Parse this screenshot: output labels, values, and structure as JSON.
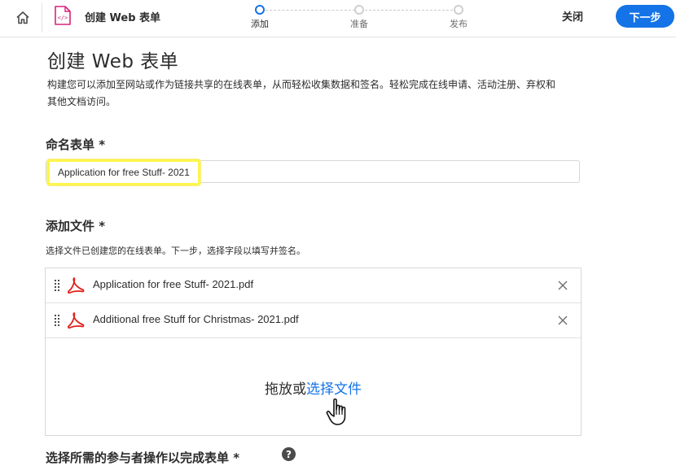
{
  "header": {
    "title": "创建 Web 表单",
    "steps": [
      {
        "label": "添加",
        "active": true
      },
      {
        "label": "准备",
        "active": false
      },
      {
        "label": "发布",
        "active": false
      }
    ],
    "close_label": "关闭",
    "next_label": "下一步"
  },
  "main": {
    "title": "创建 Web 表单",
    "description": "构建您可以添加至网站或作为链接共享的在线表单，从而轻松收集数据和签名。轻松完成在线申请、活动注册、弃权和其他文档访问。",
    "name_section": {
      "label": "命名表单 *",
      "value": "Application for free Stuff- 2021"
    },
    "files_section": {
      "label": "添加文件 *",
      "help": "选择文件已创建您的在线表单。下一步，选择字段以填写并签名。",
      "files": [
        {
          "name": "Application for free Stuff- 2021.pdf"
        },
        {
          "name": "Additional free Stuff for Christmas- 2021.pdf"
        }
      ],
      "drop_prefix": "拖放或",
      "drop_link": "选择文件"
    },
    "participants_section": {
      "label": "选择所需的参与者操作以完成表单 *",
      "help_glyph": "?"
    }
  },
  "colors": {
    "accent": "#1473e6",
    "highlight": "#fff54a",
    "pdf_red": "#e0201b"
  },
  "icons": [
    "home-icon",
    "web-form-icon",
    "drag-handle-icon",
    "pdf-icon",
    "close-icon",
    "hand-cursor-icon",
    "help-icon"
  ]
}
